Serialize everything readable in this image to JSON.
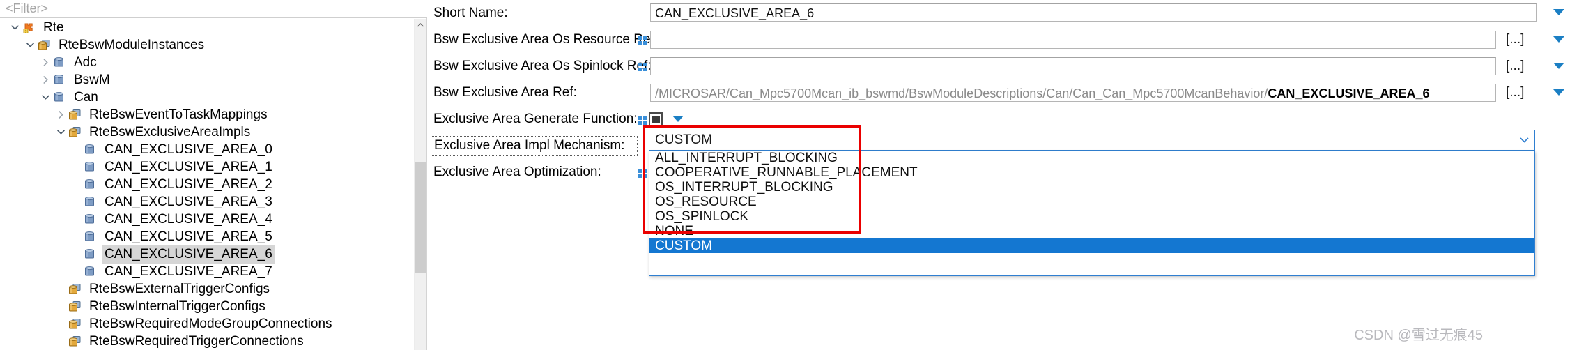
{
  "filter": {
    "placeholder": "<Filter>"
  },
  "tree": {
    "items": [
      {
        "label": "Rte",
        "depth": 0,
        "twisty": "expanded",
        "icon": "rte-module-icon"
      },
      {
        "label": "RteBswModuleInstances",
        "depth": 1,
        "twisty": "expanded",
        "icon": "container-list-icon"
      },
      {
        "label": "Adc",
        "depth": 2,
        "twisty": "collapsed",
        "icon": "container-icon"
      },
      {
        "label": "BswM",
        "depth": 2,
        "twisty": "collapsed",
        "icon": "container-icon"
      },
      {
        "label": "Can",
        "depth": 2,
        "twisty": "expanded",
        "icon": "container-icon"
      },
      {
        "label": "RteBswEventToTaskMappings",
        "depth": 3,
        "twisty": "collapsed",
        "icon": "container-list-icon"
      },
      {
        "label": "RteBswExclusiveAreaImpls",
        "depth": 3,
        "twisty": "expanded",
        "icon": "container-list-icon"
      },
      {
        "label": "CAN_EXCLUSIVE_AREA_0",
        "depth": 4,
        "twisty": "none",
        "icon": "container-icon"
      },
      {
        "label": "CAN_EXCLUSIVE_AREA_1",
        "depth": 4,
        "twisty": "none",
        "icon": "container-icon"
      },
      {
        "label": "CAN_EXCLUSIVE_AREA_2",
        "depth": 4,
        "twisty": "none",
        "icon": "container-icon"
      },
      {
        "label": "CAN_EXCLUSIVE_AREA_3",
        "depth": 4,
        "twisty": "none",
        "icon": "container-icon"
      },
      {
        "label": "CAN_EXCLUSIVE_AREA_4",
        "depth": 4,
        "twisty": "none",
        "icon": "container-icon"
      },
      {
        "label": "CAN_EXCLUSIVE_AREA_5",
        "depth": 4,
        "twisty": "none",
        "icon": "container-icon"
      },
      {
        "label": "CAN_EXCLUSIVE_AREA_6",
        "depth": 4,
        "twisty": "none",
        "icon": "container-icon",
        "selected": true
      },
      {
        "label": "CAN_EXCLUSIVE_AREA_7",
        "depth": 4,
        "twisty": "none",
        "icon": "container-icon"
      },
      {
        "label": "RteBswExternalTriggerConfigs",
        "depth": 3,
        "twisty": "none",
        "icon": "container-list-icon"
      },
      {
        "label": "RteBswInternalTriggerConfigs",
        "depth": 3,
        "twisty": "none",
        "icon": "container-list-icon"
      },
      {
        "label": "RteBswRequiredModeGroupConnections",
        "depth": 3,
        "twisty": "none",
        "icon": "container-list-icon"
      },
      {
        "label": "RteBswRequiredTriggerConnections",
        "depth": 3,
        "twisty": "none",
        "icon": "container-list-icon"
      }
    ]
  },
  "form": {
    "rows": {
      "short_name": {
        "label": "Short Name:",
        "value": "CAN_EXCLUSIVE_AREA_6"
      },
      "os_resource_ref": {
        "label": "Bsw Exclusive Area Os Resource Ref:",
        "value": "",
        "browse_label": "[...]"
      },
      "os_spinlock_ref": {
        "label": "Bsw Exclusive Area Os Spinlock Ref:",
        "value": "",
        "browse_label": "[...]"
      },
      "area_ref": {
        "label": "Bsw Exclusive Area Ref:",
        "value_prefix": "/MICROSAR/Can_Mpc5700Mcan_ib_bswmd/BswModuleDescriptions/Can/Can_Can_Mpc5700McanBehavior/",
        "value_bold": "CAN_EXCLUSIVE_AREA_6",
        "browse_label": "[...]"
      },
      "generate_function": {
        "label": "Exclusive Area Generate Function:",
        "checkbox_state": "filled"
      },
      "impl_mechanism": {
        "label": "Exclusive Area Impl Mechanism:",
        "value": "CUSTOM",
        "focused": true
      },
      "optimization": {
        "label": "Exclusive Area Optimization:"
      }
    },
    "dropdown": {
      "open": true,
      "options": [
        "ALL_INTERRUPT_BLOCKING",
        "COOPERATIVE_RUNNABLE_PLACEMENT",
        "OS_INTERRUPT_BLOCKING",
        "OS_RESOURCE",
        "OS_SPINLOCK",
        "NONE",
        "CUSTOM"
      ],
      "selected_index": 6
    }
  },
  "annotation": {
    "highlight_color": "#ea0000"
  },
  "watermark": {
    "text": "CSDN @雪过无痕45"
  }
}
